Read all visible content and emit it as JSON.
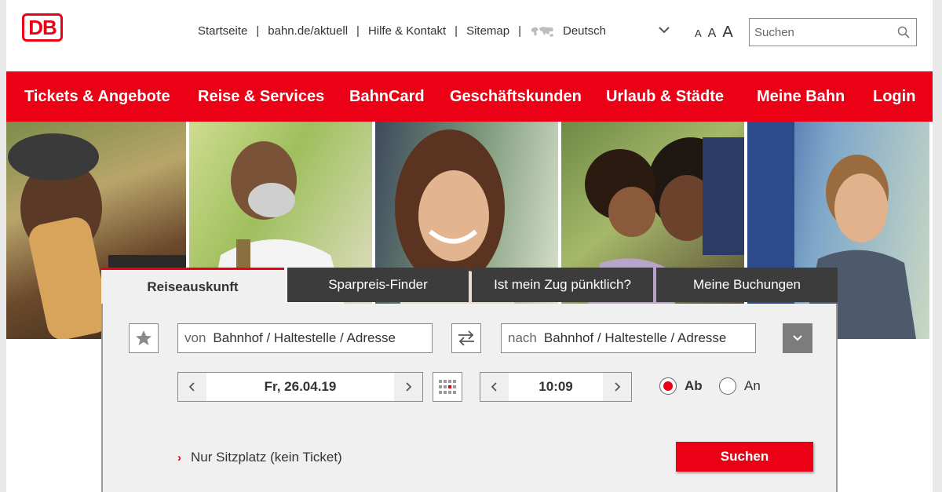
{
  "header": {
    "logo_text": "DB",
    "top_links": [
      "Startseite",
      "bahn.de/aktuell",
      "Hilfe & Kontakt",
      "Sitemap"
    ],
    "language": "Deutsch",
    "font_size_labels": [
      "A",
      "A",
      "A"
    ],
    "search_placeholder": "Suchen"
  },
  "main_nav": {
    "items": [
      "Tickets & Angebote",
      "Reise & Services",
      "BahnCard",
      "Geschäftskunden",
      "Urlaub & Städte",
      "Meine Bahn",
      "Login"
    ]
  },
  "booking": {
    "tabs": [
      "Reiseauskunft",
      "Sparpreis-Finder",
      "Ist mein Zug pünktlich?",
      "Meine Buchungen"
    ],
    "active_tab": "Reiseauskunft",
    "from_label": "von",
    "from_placeholder": "Bahnhof / Haltestelle / Adresse",
    "to_label": "nach",
    "to_placeholder": "Bahnhof / Haltestelle / Adresse",
    "date_value": "Fr, 26.04.19",
    "time_value": "10:09",
    "radio_departure": "Ab",
    "radio_arrival": "An",
    "selected_radio": "Ab",
    "seat_link": "Nur Sitzplatz (kein Ticket)",
    "submit_label": "Suchen"
  },
  "colors": {
    "brand_red": "#ec0016",
    "dark_tab": "#3c3c3c",
    "panel_bg": "#f0f0f0"
  }
}
